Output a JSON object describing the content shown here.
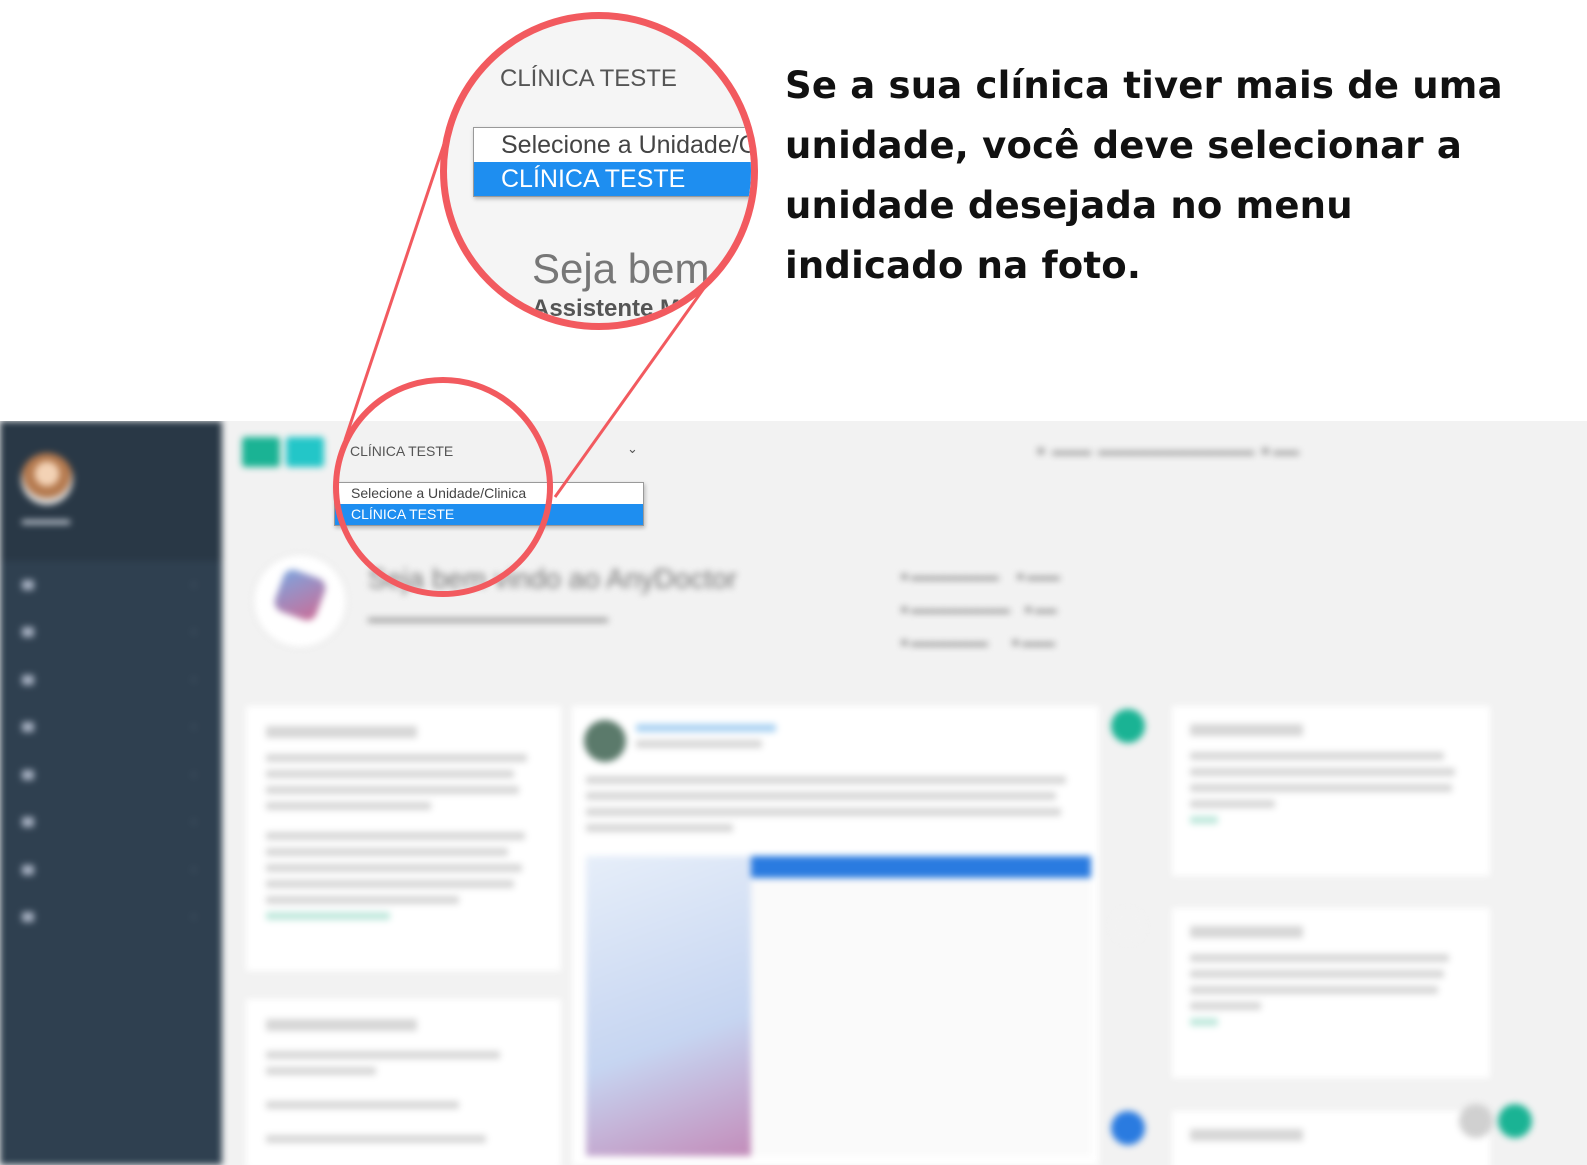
{
  "instruction": {
    "line1": "Se a sua clínica tiver mais de uma",
    "line2": "unidade, você deve selecionar a",
    "line3": "unidade desejada no menu",
    "line4": "indicado na foto."
  },
  "unit_select": {
    "current": "CLÍNICA TESTE",
    "options": [
      "Selecione a Unidade/Clinica",
      "CLÍNICA TESTE"
    ],
    "selected_index": 1
  },
  "magnifier": {
    "label": "CLÍNICA TESTE",
    "option_1": "Selecione a Unidade/C",
    "option_2": "CLÍNICA TESTE",
    "welcome_partial": "Seja bem vi",
    "role_partial": "Assistente Mé"
  },
  "welcome": {
    "title": "Seja bem vindo ao AnyDoctor"
  },
  "colors": {
    "highlight_ring": "#f25a5f",
    "selected_option": "#1e8ef0",
    "sidebar": "#2f4050",
    "primary_button": "#1ab394",
    "secondary_button": "#23c6c8"
  }
}
